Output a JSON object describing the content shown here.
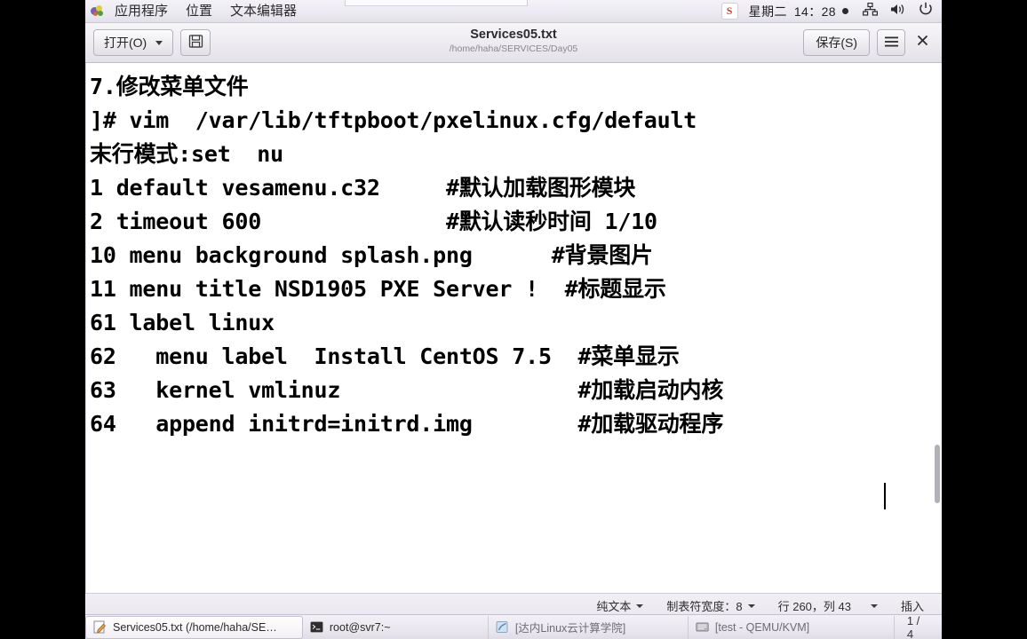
{
  "top_panel": {
    "app_menu": "应用程序",
    "places_menu": "位置",
    "app_name_menu": "文本编辑器",
    "ime_icon_label": "S",
    "weekday": "星期二",
    "clock": "14：28",
    "network_icon": "network-icon",
    "volume_icon": "volume-icon",
    "power_icon": "power-icon"
  },
  "window": {
    "open_button": "打开(O)",
    "save_button": "保存(S)",
    "menu_button_icon": "hamburger-menu-icon",
    "save_icon": "save-disk-icon",
    "close_button_icon": "close-icon",
    "title": "Services05.txt",
    "path": "/home/haha/SERVICES/Day05"
  },
  "document": {
    "lines": [
      "7.修改菜单文件",
      "]# vim  /var/lib/tftpboot/pxelinux.cfg/default",
      "末行模式:set  nu",
      "1 default vesamenu.c32     #默认加载图形模块",
      "2 timeout 600              #默认读秒时间 1/10",
      "",
      "",
      "10 menu background splash.png      #背景图片",
      "11 menu title NSD1905 PXE Server !  #标题显示",
      "",
      "",
      "61 label linux",
      "62   menu label  Install CentOS 7.5  #菜单显示",
      "63   kernel vmlinuz                  #加载启动内核",
      "64   append initrd=initrd.img        #加载驱动程序"
    ]
  },
  "statusbar": {
    "file_type": "纯文本",
    "tab_width": "制表符宽度：8",
    "position": "行 260，列 43",
    "insert_mode": "插入"
  },
  "taskbar": {
    "items": [
      {
        "label": "Services05.txt (/home/haha/SE…",
        "icon": "gedit-icon",
        "active": true
      },
      {
        "label": "root@svr7:~",
        "icon": "terminal-icon",
        "active": false
      },
      {
        "label": "[达内Linux云计算学院]",
        "icon": "browser-icon",
        "active": false
      },
      {
        "label": "[test - QEMU/KVM]",
        "icon": "vm-icon",
        "active": false
      }
    ],
    "workspace": "1 / 4"
  },
  "colors": {
    "panel_bg": "#eceaf2",
    "editor_bg": "#ffffff",
    "text": "#000000",
    "accent": "#7e5ea8"
  }
}
